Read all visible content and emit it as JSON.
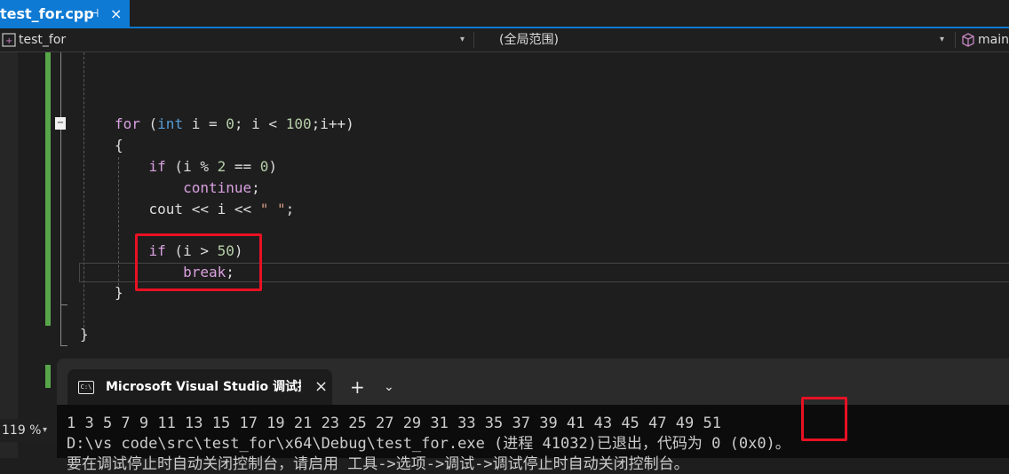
{
  "tab": {
    "filename": "test_for.cpp",
    "pin": "⊣",
    "close": "×"
  },
  "nav": {
    "project": "test_for",
    "scope": "(全局范围)",
    "member": "main",
    "dropdown": "▾"
  },
  "editor": {
    "collapse_marker": "−",
    "lines": [
      {
        "indent": "",
        "tokens": [
          {
            "t": "for",
            "c": "kw"
          },
          {
            "t": " (",
            "c": ""
          },
          {
            "t": "int",
            "c": "kw2"
          },
          {
            "t": " i = ",
            "c": ""
          },
          {
            "t": "0",
            "c": "num"
          },
          {
            "t": "; i < ",
            "c": ""
          },
          {
            "t": "100",
            "c": "num"
          },
          {
            "t": ";i++)",
            "c": ""
          }
        ]
      },
      {
        "indent": "",
        "tokens": [
          {
            "t": "{",
            "c": ""
          }
        ]
      },
      {
        "indent": "    ",
        "tokens": [
          {
            "t": "if",
            "c": "kw"
          },
          {
            "t": " (i % ",
            "c": ""
          },
          {
            "t": "2",
            "c": "num"
          },
          {
            "t": " == ",
            "c": ""
          },
          {
            "t": "0",
            "c": "num"
          },
          {
            "t": ")",
            "c": ""
          }
        ]
      },
      {
        "indent": "        ",
        "tokens": [
          {
            "t": "continue",
            "c": "kw"
          },
          {
            "t": ";",
            "c": ""
          }
        ]
      },
      {
        "indent": "    ",
        "tokens": [
          {
            "t": "cout << i << ",
            "c": ""
          },
          {
            "t": "\" \"",
            "c": "str"
          },
          {
            "t": ";",
            "c": ""
          }
        ]
      },
      {
        "indent": "    ",
        "tokens": [
          {
            "t": "if",
            "c": "kw"
          },
          {
            "t": " (i > ",
            "c": ""
          },
          {
            "t": "50",
            "c": "num"
          },
          {
            "t": ")",
            "c": ""
          }
        ]
      },
      {
        "indent": "        ",
        "tokens": [
          {
            "t": "break",
            "c": "kw"
          },
          {
            "t": ";",
            "c": ""
          }
        ]
      },
      {
        "indent": "",
        "tokens": [
          {
            "t": "}",
            "c": ""
          }
        ]
      },
      {
        "indent": "",
        "tokens": [
          {
            "t": "}",
            "c": ""
          }
        ]
      }
    ],
    "zoom": "119 %"
  },
  "console": {
    "tab_title": "Microsoft Visual Studio 调试控制台",
    "close": "×",
    "plus": "+",
    "chevron": "⌄",
    "icon_text": "C:\\",
    "output_numbers": "1 3 5 7 9 11 13 15 17 19 21 23 25 27 29 31 33 35 37 39 41 43 45 47 49 ",
    "output_last": "51",
    "exit_line": "D:\\vs code\\src\\test_for\\x64\\Debug\\test_for.exe (进程 41032)已退出，代码为 0 (0x0)。",
    "hint_line": "要在调试停止时自动关闭控制台，请启用 工具->选项->调试->调试停止时自动关闭控制台。"
  }
}
